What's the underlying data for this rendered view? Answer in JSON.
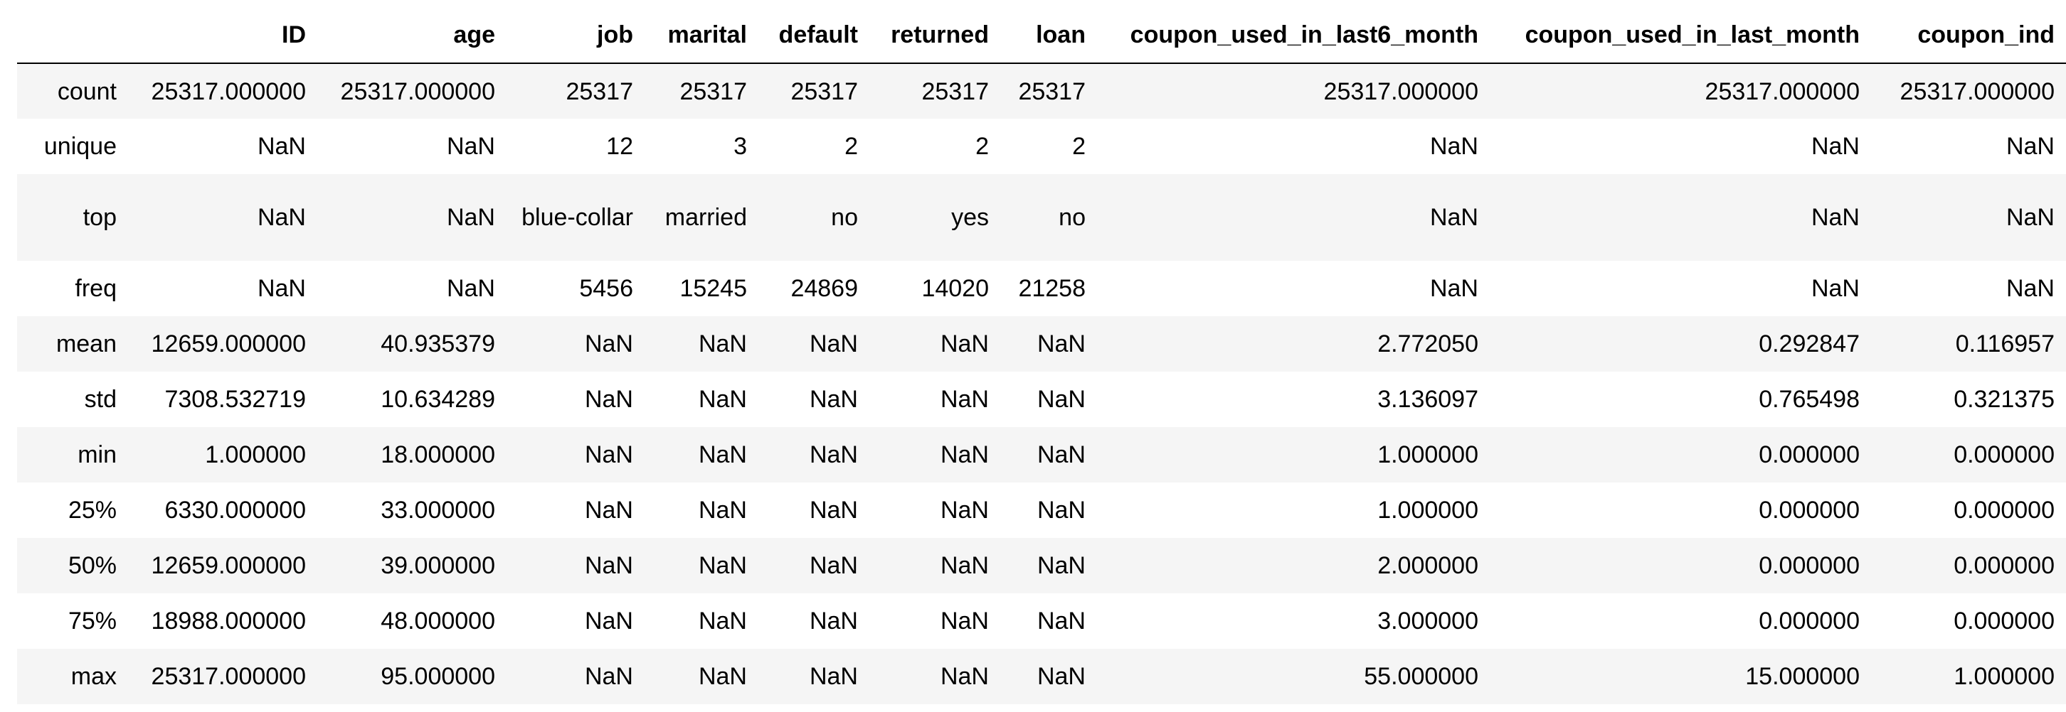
{
  "table": {
    "columns": [
      "",
      "ID",
      "age",
      "job",
      "marital",
      "default",
      "returned",
      "loan",
      "coupon_used_in_last6_month",
      "coupon_used_in_last_month",
      "coupon_ind"
    ],
    "rows": [
      {
        "label": "count",
        "values": [
          "25317.000000",
          "25317.000000",
          "25317",
          "25317",
          "25317",
          "25317",
          "25317",
          "25317.000000",
          "25317.000000",
          "25317.000000"
        ]
      },
      {
        "label": "unique",
        "values": [
          "NaN",
          "NaN",
          "12",
          "3",
          "2",
          "2",
          "2",
          "NaN",
          "NaN",
          "NaN"
        ]
      },
      {
        "label": "top",
        "values": [
          "NaN",
          "NaN",
          "blue-collar",
          "married",
          "no",
          "yes",
          "no",
          "NaN",
          "NaN",
          "NaN"
        ]
      },
      {
        "label": "freq",
        "values": [
          "NaN",
          "NaN",
          "5456",
          "15245",
          "24869",
          "14020",
          "21258",
          "NaN",
          "NaN",
          "NaN"
        ]
      },
      {
        "label": "mean",
        "values": [
          "12659.000000",
          "40.935379",
          "NaN",
          "NaN",
          "NaN",
          "NaN",
          "NaN",
          "2.772050",
          "0.292847",
          "0.116957"
        ]
      },
      {
        "label": "std",
        "values": [
          "7308.532719",
          "10.634289",
          "NaN",
          "NaN",
          "NaN",
          "NaN",
          "NaN",
          "3.136097",
          "0.765498",
          "0.321375"
        ]
      },
      {
        "label": "min",
        "values": [
          "1.000000",
          "18.000000",
          "NaN",
          "NaN",
          "NaN",
          "NaN",
          "NaN",
          "1.000000",
          "0.000000",
          "0.000000"
        ]
      },
      {
        "label": "25%",
        "values": [
          "6330.000000",
          "33.000000",
          "NaN",
          "NaN",
          "NaN",
          "NaN",
          "NaN",
          "1.000000",
          "0.000000",
          "0.000000"
        ]
      },
      {
        "label": "50%",
        "values": [
          "12659.000000",
          "39.000000",
          "NaN",
          "NaN",
          "NaN",
          "NaN",
          "NaN",
          "2.000000",
          "0.000000",
          "0.000000"
        ]
      },
      {
        "label": "75%",
        "values": [
          "18988.000000",
          "48.000000",
          "NaN",
          "NaN",
          "NaN",
          "NaN",
          "NaN",
          "3.000000",
          "0.000000",
          "0.000000"
        ]
      },
      {
        "label": "max",
        "values": [
          "25317.000000",
          "95.000000",
          "NaN",
          "NaN",
          "NaN",
          "NaN",
          "NaN",
          "55.000000",
          "15.000000",
          "1.000000"
        ]
      }
    ]
  },
  "colors": {
    "stripe": "#f5f5f5",
    "background": "#ffffff",
    "header_rule": "#000000"
  }
}
